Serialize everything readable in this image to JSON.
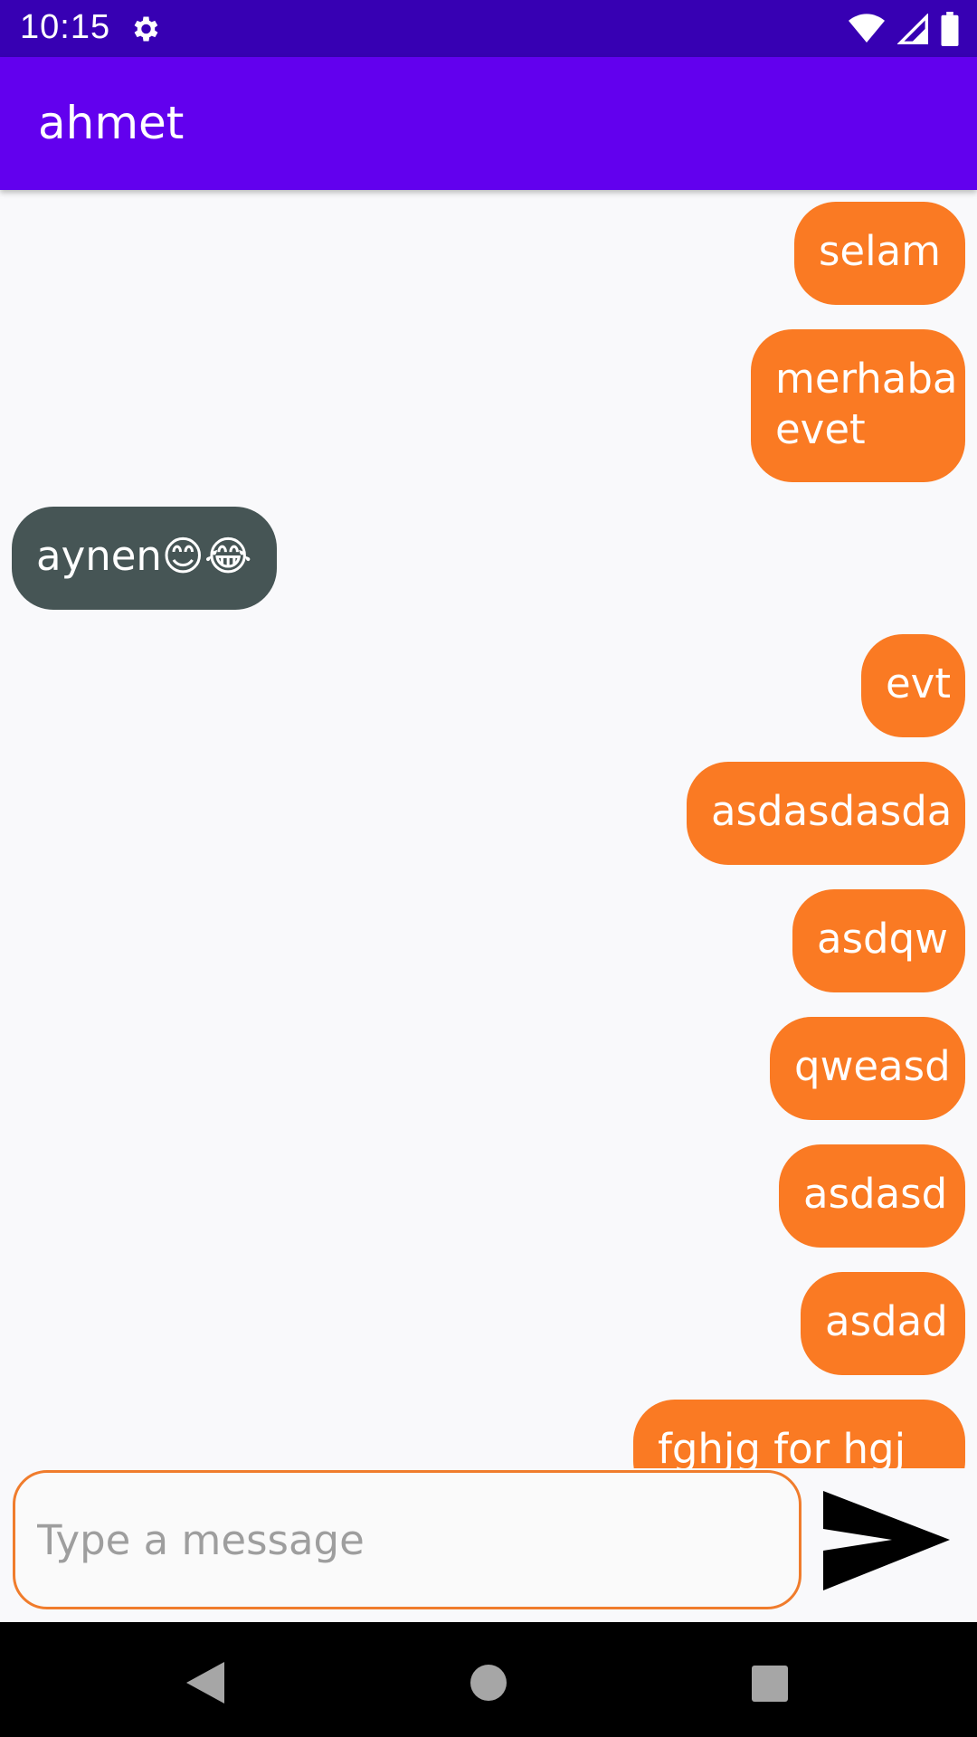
{
  "status_bar": {
    "time": "10:15",
    "icons": [
      "gear-icon",
      "wifi-icon",
      "cell-signal-icon",
      "battery-icon"
    ]
  },
  "app_bar": {
    "title": "ahmet"
  },
  "messages": [
    {
      "text": "selam",
      "direction": "outgoing"
    },
    {
      "text": "merhaba\nevet",
      "direction": "outgoing"
    },
    {
      "text": "aynen😊😂",
      "direction": "incoming"
    },
    {
      "text": "evt",
      "direction": "outgoing"
    },
    {
      "text": "asdasdasda",
      "direction": "outgoing"
    },
    {
      "text": "asdqw",
      "direction": "outgoing"
    },
    {
      "text": "qweasd",
      "direction": "outgoing"
    },
    {
      "text": "asdasd",
      "direction": "outgoing"
    },
    {
      "text": "asdad",
      "direction": "outgoing"
    },
    {
      "text": "fghjg for hgj gh",
      "direction": "outgoing"
    }
  ],
  "composer": {
    "placeholder": "Type a message",
    "value": "",
    "send_icon": "send-icon"
  },
  "nav_bar": {
    "icons": [
      "back-icon",
      "home-icon",
      "recents-icon"
    ]
  },
  "colors": {
    "status_bar": "#3700b3",
    "app_bar": "#6200ee",
    "outgoing_bubble": "#fa7a23",
    "incoming_bubble": "#465555",
    "input_border": "#f07c2c"
  }
}
